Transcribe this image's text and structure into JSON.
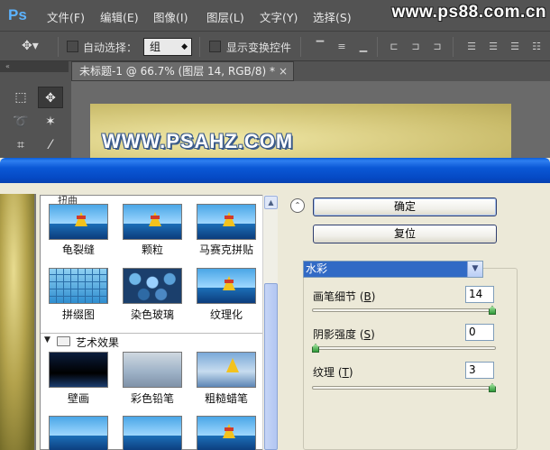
{
  "app": {
    "logo": "Ps",
    "watermark": "www.ps88.com.cn"
  },
  "menu": [
    "文件(F)",
    "编辑(E)",
    "图像(I)",
    "图层(L)",
    "文字(Y)",
    "选择(S)"
  ],
  "options": {
    "auto_select_label": "自动选择：",
    "auto_select_target": "组",
    "show_transform_label": "显示变换控件",
    "auto_select_checked": false,
    "show_transform_checked": false
  },
  "document": {
    "tab_title": "未标题-1 @ 66.7% (图层 14, RGB/8) *",
    "close_glyph": "×",
    "canvas_text": "WWW.PSAHZ.COM"
  },
  "gallery": {
    "partial_category": "扭曲",
    "row1": [
      "龟裂缝",
      "颗粒",
      "马赛克拼贴"
    ],
    "row2": [
      "拼缀图",
      "染色玻璃",
      "纹理化"
    ],
    "category": "艺术效果",
    "row3": [
      "壁画",
      "彩色铅笔",
      "粗糙蜡笔"
    ]
  },
  "buttons": {
    "ok": "确定",
    "reset": "复位"
  },
  "filter": {
    "selected": "水彩",
    "params": [
      {
        "label_pre": "画笔细节 (",
        "mnemonic": "B",
        "label_post": ")",
        "value": "14",
        "fraction": 1.0
      },
      {
        "label_pre": "阴影强度 (",
        "mnemonic": "S",
        "label_post": ")",
        "value": "0",
        "fraction": 0.0
      },
      {
        "label_pre": "纹理 (",
        "mnemonic": "T",
        "label_post": ")",
        "value": "3",
        "fraction": 1.0
      }
    ]
  },
  "icons": {
    "move_tool": "move-tool-icon",
    "collapse": "double-chevron-up-icon"
  }
}
